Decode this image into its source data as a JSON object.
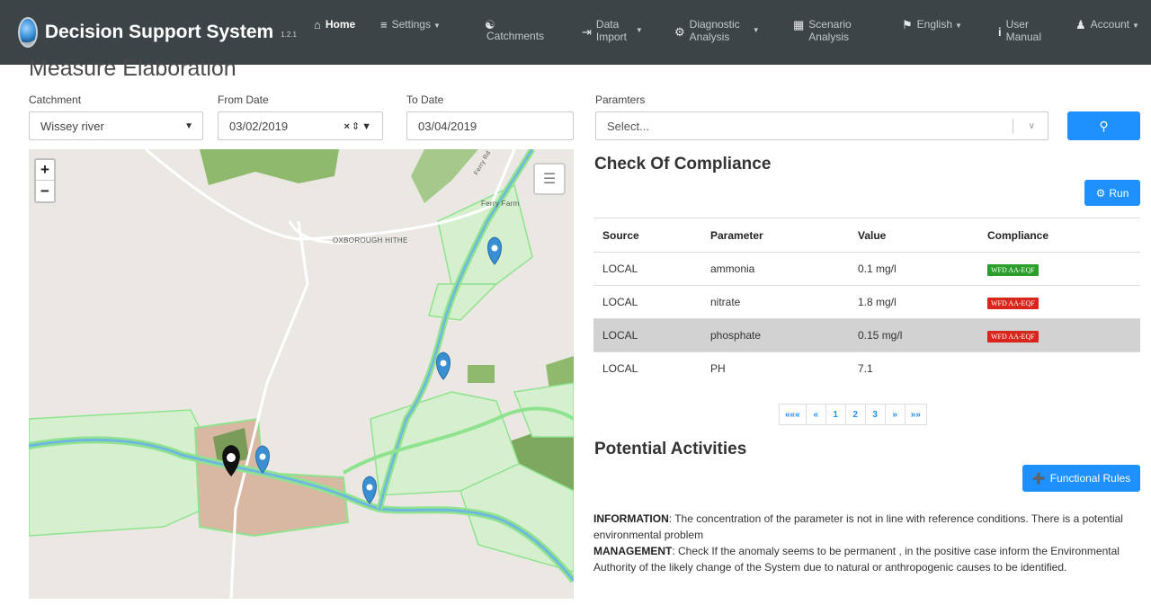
{
  "navbar": {
    "title": "Decision Support System",
    "version": "1.2.1",
    "items": [
      {
        "label": "Home",
        "icon": "home-icon"
      },
      {
        "label": "Settings",
        "icon": "sliders-icon"
      },
      {
        "label": "Catchments",
        "icon": "globe-icon"
      },
      {
        "line1": "Data",
        "line2": "Import",
        "icon": "import-icon"
      },
      {
        "line1": "Diagnostic",
        "line2": "Analysis",
        "icon": "cogs-icon"
      },
      {
        "line1": "Scenario",
        "line2": "Analysis",
        "icon": "table-icon"
      },
      {
        "label": "English",
        "icon": "flag-icon"
      },
      {
        "line1": "User",
        "line2": "Manual",
        "icon": "info-icon"
      },
      {
        "label": "Account",
        "icon": "user-icon"
      }
    ]
  },
  "page": {
    "title": "Measure Elaboration"
  },
  "filters": {
    "catchment_label": "Catchment",
    "catchment_value": "Wissey river",
    "from_label": "From Date",
    "from_value": "03/02/2019",
    "to_label": "To Date",
    "to_value": "03/04/2019",
    "params_label": "Paramters",
    "params_placeholder": "Select..."
  },
  "map": {
    "label_hithe": "OXBOROUGH HITHE",
    "label_farm": "Ferry Farm",
    "label_road": "Ferry Rd"
  },
  "compliance": {
    "title": "Check Of Compliance",
    "run_label": "Run",
    "columns": [
      "Source",
      "Parameter",
      "Value",
      "Compliance"
    ],
    "rows": [
      {
        "source": "LOCAL",
        "parameter": "ammonia",
        "value": "0.1 mg/l",
        "badge": "WFD AA-EQF",
        "status": "pass"
      },
      {
        "source": "LOCAL",
        "parameter": "nitrate",
        "value": "1.8 mg/l",
        "badge": "WFD AA-EQF",
        "status": "fail"
      },
      {
        "source": "LOCAL",
        "parameter": "phosphate",
        "value": "0.15 mg/l",
        "badge": "WFD AA-EQF",
        "status": "fail"
      },
      {
        "source": "LOCAL",
        "parameter": "PH",
        "value": "7.1",
        "badge": "",
        "status": ""
      }
    ],
    "pagination": [
      "«««",
      "«",
      "1",
      "2",
      "3",
      "»",
      "»»"
    ]
  },
  "activities": {
    "title": "Potential Activities",
    "button_label": "Functional Rules",
    "info_key": "INFORMATION",
    "info_text": ": The concentration of the parameter is not in line with reference conditions. There is a potential environmental problem",
    "mgmt_key": "MANAGEMENT",
    "mgmt_text": ": Check If the anomaly seems to be permanent , in the positive case inform the Environmental Authority of the likely change of the System due to natural or anthropogenic causes to be identified."
  },
  "colors": {
    "navbar": "#3d4448",
    "primary": "#1e90ff",
    "badge_fail": "#d9261c",
    "badge_pass": "#2a9d2a",
    "river": "#6fb6e0",
    "field_outline": "#8fe38f"
  }
}
